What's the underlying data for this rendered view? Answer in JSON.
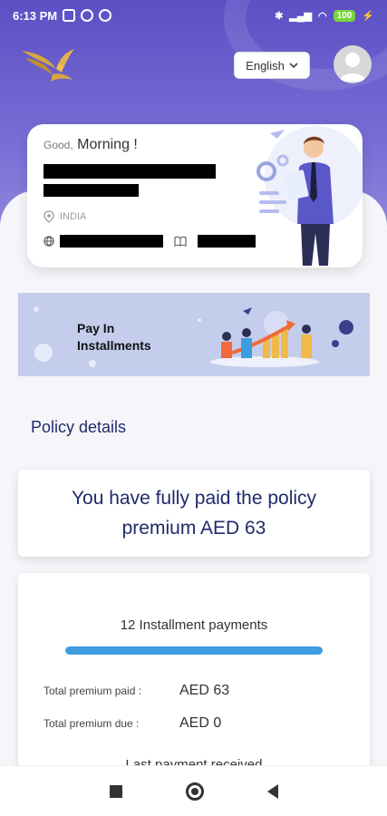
{
  "status_bar": {
    "time": "6:13 PM",
    "battery": "100"
  },
  "header": {
    "language": "English"
  },
  "greeting": {
    "prefix": "Good,",
    "salutation": "Morning !",
    "country": "INDIA"
  },
  "banner": {
    "line1": "Pay In",
    "line2": "Installments"
  },
  "policy": {
    "section_title": "Policy details",
    "paid_message": "You have fully paid the policy premium AED 63",
    "installments_title": "12 Installment payments",
    "progress": 1.0,
    "total_paid_label": "Total premium paid :",
    "total_paid_value": "AED 63",
    "total_due_label": "Total premium due :",
    "total_due_value": "AED 0",
    "last_payment_label": "Last payment received"
  },
  "colors": {
    "header_start": "#5c4fc4",
    "accent_text": "#1f2a6b",
    "progress": "#3c9de0"
  }
}
